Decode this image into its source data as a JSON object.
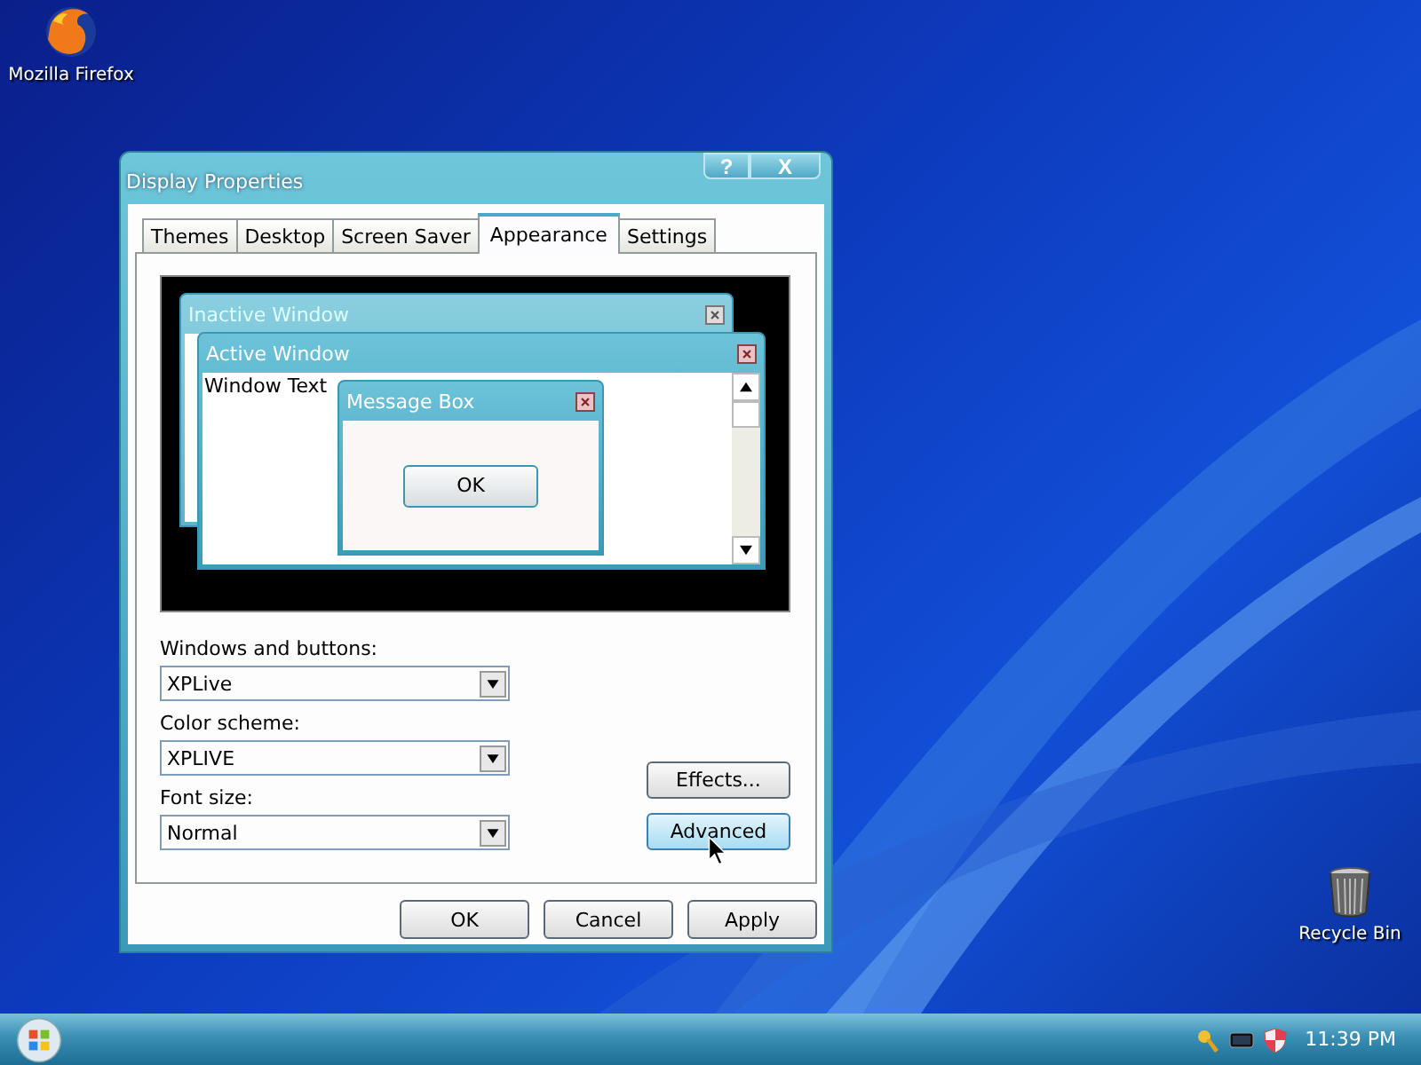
{
  "desktop_icons": [
    {
      "label": "Mozilla Firefox",
      "kind": "browser"
    },
    {
      "label": "Recycle Bin",
      "kind": "trash"
    }
  ],
  "window": {
    "title": "Display Properties",
    "help_button": "?",
    "close_button": "X"
  },
  "tabs": [
    {
      "label": "Themes",
      "selected": false
    },
    {
      "label": "Desktop",
      "selected": false
    },
    {
      "label": "Screen Saver",
      "selected": false
    },
    {
      "label": "Appearance",
      "selected": true
    },
    {
      "label": "Settings",
      "selected": false
    }
  ],
  "preview": {
    "inactive_title": "Inactive Window",
    "active_title": "Active Window",
    "window_text": "Window Text",
    "message_title": "Message Box",
    "message_button": "OK"
  },
  "fields": [
    {
      "label": "Windows and buttons:",
      "value": "XPLive"
    },
    {
      "label": "Color scheme:",
      "value": "XPLIVE"
    },
    {
      "label": "Font size:",
      "value": "Normal"
    }
  ],
  "side_buttons": [
    {
      "label": "Effects...",
      "hovered": false
    },
    {
      "label": "Advanced",
      "hovered": true
    }
  ],
  "dialog_buttons": [
    "OK",
    "Cancel",
    "Apply"
  ],
  "tray": {
    "clock": "11:39 PM"
  }
}
